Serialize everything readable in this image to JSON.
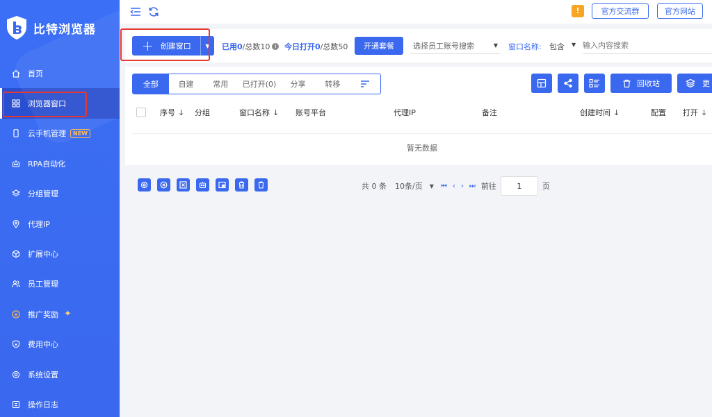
{
  "app": {
    "name": "比特浏览器"
  },
  "sidebar": {
    "items": [
      {
        "label": "首页",
        "icon": "home-icon"
      },
      {
        "label": "浏览器窗口",
        "icon": "grid-icon",
        "active": true
      },
      {
        "label": "云手机管理",
        "icon": "phone-icon",
        "badge": "NEW"
      },
      {
        "label": "RPA自动化",
        "icon": "robot-icon"
      },
      {
        "label": "分组管理",
        "icon": "layers-icon"
      },
      {
        "label": "代理IP",
        "icon": "location-icon"
      },
      {
        "label": "扩展中心",
        "icon": "cube-icon"
      },
      {
        "label": "员工管理",
        "icon": "users-icon"
      },
      {
        "label": "推广奖励",
        "icon": "reward-icon"
      },
      {
        "label": "费用中心",
        "icon": "shield-icon"
      },
      {
        "label": "系统设置",
        "icon": "gear-icon"
      },
      {
        "label": "操作日志",
        "icon": "log-icon"
      }
    ]
  },
  "topbar": {
    "warn_badge": "!",
    "community_btn": "官方交流群",
    "website_btn": "官方网站"
  },
  "toolbar": {
    "create_label": "创建窗口",
    "used_label": "已用",
    "used_value": "0",
    "total_label": "/总数10",
    "today_label": "今日打开",
    "today_value": "0",
    "today_total": "/总数50",
    "plan_btn": "开通套餐",
    "staff_placeholder": "选择员工账号搜索",
    "filter_label": "窗口名称:",
    "filter_op": "包含",
    "search_placeholder": "输入内容搜索"
  },
  "tabs": [
    "全部",
    "自建",
    "常用",
    "已打开(0)",
    "分享",
    "转移"
  ],
  "actions": {
    "recycle": "回收站",
    "more": "更"
  },
  "table": {
    "headers": {
      "seq": "序号",
      "group": "分组",
      "name": "窗口名称",
      "platform": "账号平台",
      "proxy": "代理IP",
      "remark": "备注",
      "created": "创建时间",
      "config": "配置",
      "open": "打开"
    },
    "empty_text": "暂无数据"
  },
  "pager": {
    "total": "共 0 条",
    "page_size": "10条/页",
    "goto_label": "前往",
    "page": "1",
    "page_suffix": "页"
  },
  "colors": {
    "primary": "#3a68ee",
    "highlight": "#e53935",
    "warning": "#f6a623"
  }
}
